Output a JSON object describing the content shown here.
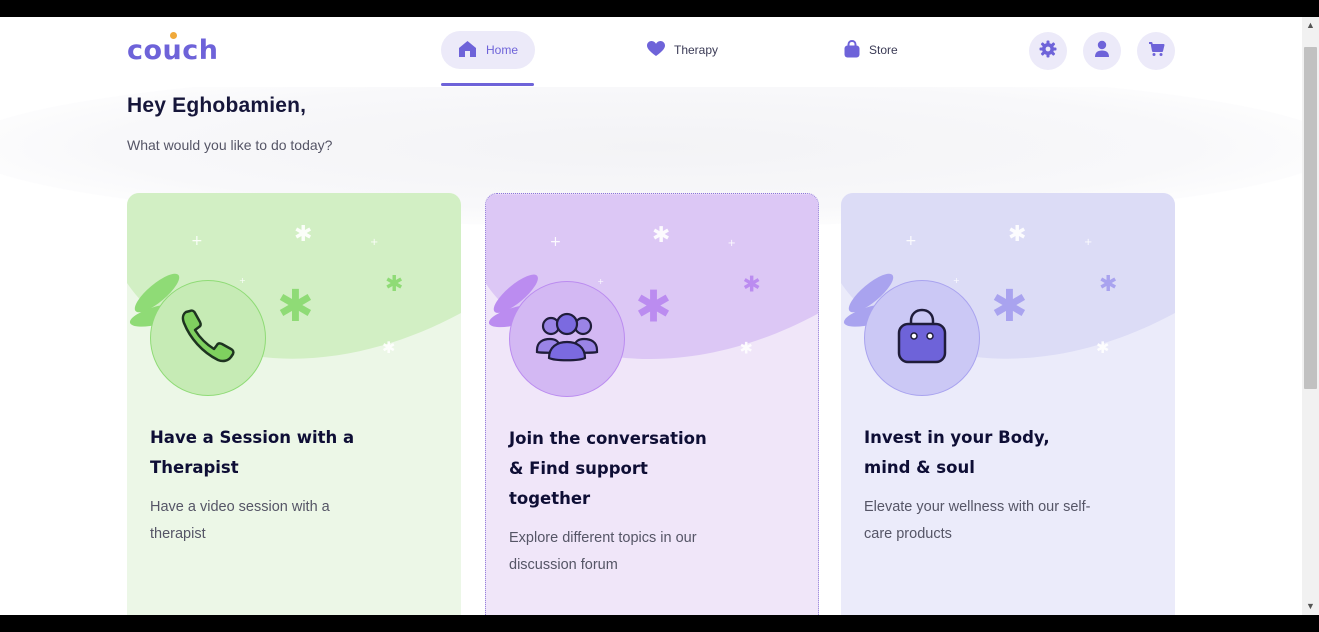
{
  "brand": {
    "logo_text": "couch",
    "color": "#6e63d9",
    "dot_color": "#f0a93a"
  },
  "nav": {
    "tabs": [
      {
        "label": "Home",
        "icon": "home-icon",
        "active": true
      },
      {
        "label": "Therapy",
        "icon": "heart-icon",
        "active": false
      },
      {
        "label": "Store",
        "icon": "shopping-bag-icon",
        "active": false
      }
    ],
    "actions": [
      {
        "icon": "gear-icon"
      },
      {
        "icon": "user-icon"
      },
      {
        "icon": "cart-icon"
      }
    ]
  },
  "greeting": {
    "title": "Hey Eghobamien,",
    "subtitle": "What would you like to do today?"
  },
  "cards": [
    {
      "title_line1": "Have a Session with a",
      "title_line2": "Therapist",
      "desc_line1": "Have a video session with a",
      "desc_line2": "therapist",
      "icon": "phone-icon",
      "color_bg": "#ecf7e7",
      "color_wave": "#d2efc4",
      "color_circle": "#c6ebb5",
      "color_accent": "#8fdb76"
    },
    {
      "title_line1": "Join the conversation",
      "title_line2": "& Find support",
      "title_line3": "together",
      "desc_line1": "Explore different topics in our",
      "desc_line2": "discussion forum",
      "icon": "community-icon",
      "color_bg": "#f0e6f9",
      "color_wave": "#dcc7f5",
      "color_circle": "#d3b8f3",
      "color_accent": "#bb8cf0"
    },
    {
      "title_line1": "Invest in your Body,",
      "title_line2": "mind & soul",
      "desc_line1": "Elevate your wellness with our self-",
      "desc_line2": "care products",
      "icon": "handbag-icon",
      "color_bg": "#ebebfa",
      "color_wave": "#dcdcf6",
      "color_circle": "#cbc8f5",
      "color_accent": "#a9a3ef"
    }
  ]
}
